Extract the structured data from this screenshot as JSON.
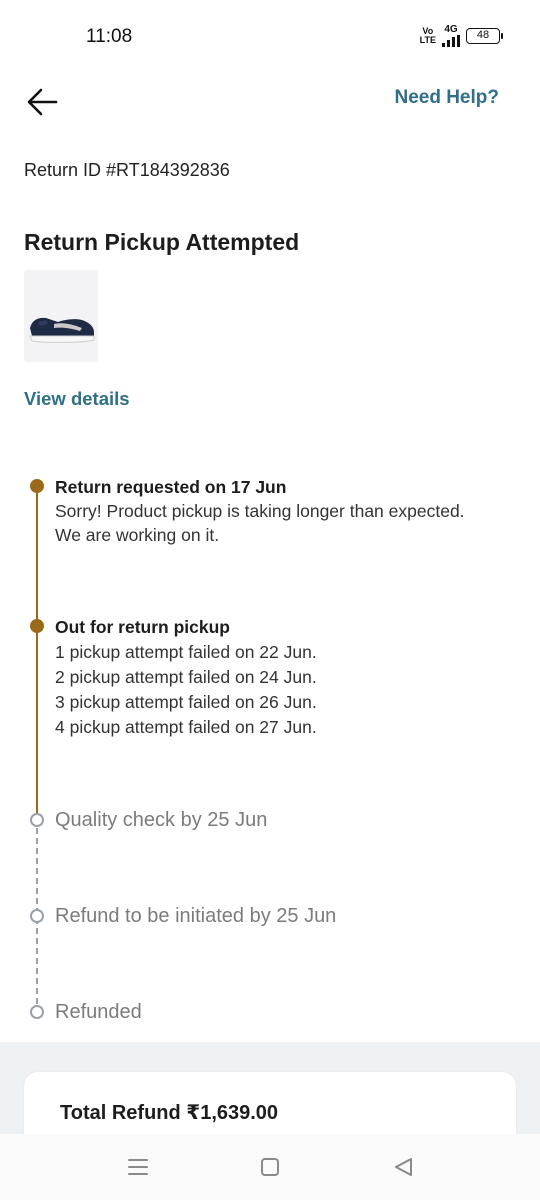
{
  "status_bar": {
    "time": "11:08",
    "volte": "Vo\nLTE",
    "network": "4G",
    "battery": "48"
  },
  "header": {
    "help_label": "Need Help?"
  },
  "return": {
    "id_text": "Return ID #RT184392836",
    "status_title": "Return Pickup Attempted",
    "view_details_label": "View details"
  },
  "timeline": {
    "step1_title": "Return requested on 17 Jun",
    "step1_lines": [
      "Sorry! Product pickup is taking longer than expected.",
      "We are working on it."
    ],
    "step2_title": "Out for return pickup",
    "step2_lines": [
      "1 pickup attempt failed on 22 Jun.",
      "2 pickup attempt failed on 24 Jun.",
      "3 pickup attempt failed on 26 Jun.",
      "4 pickup attempt failed on 27 Jun."
    ],
    "step3": "Quality check by 25 Jun",
    "step4": "Refund to be initiated by 25 Jun",
    "step5": "Refunded"
  },
  "refund": {
    "total_text": "Total Refund ₹1,639.00"
  },
  "colors": {
    "accent_link": "#2f6f88",
    "timeline_done": "#9a6a1a",
    "timeline_pending": "#9aa0a6"
  },
  "icons": {
    "back": "arrow-left-icon",
    "nav_menu": "menu-icon",
    "nav_home": "square-home-icon",
    "nav_back": "triangle-back-icon"
  }
}
